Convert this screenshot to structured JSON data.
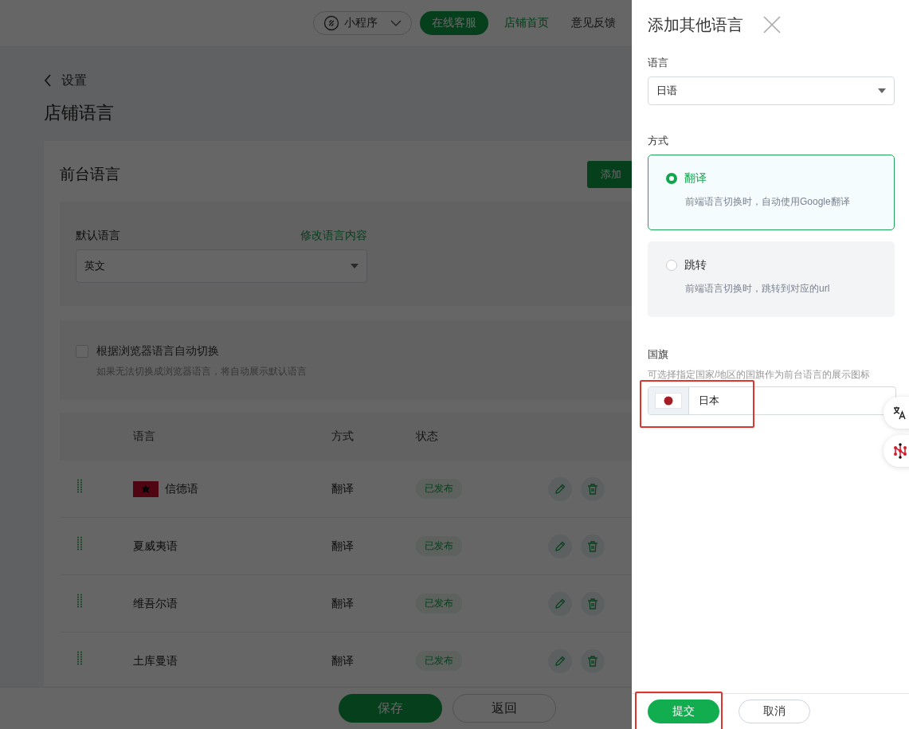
{
  "topbar": {
    "mini_program": "小程序",
    "service_button": "在线客服",
    "shop_home": "店铺首页",
    "feedback": "意见反馈"
  },
  "breadcrumb": {
    "back": "设置"
  },
  "page_title": "店铺语言",
  "card": {
    "title": "前台语言",
    "add_button": "添加"
  },
  "default_language": {
    "label": "默认语言",
    "edit_link": "修改语言内容",
    "value": "英文"
  },
  "auto_switch": {
    "label": "根据浏览器语言自动切换",
    "hint": "如果无法切换成浏览器语言，将自动展示默认语言",
    "checked": false
  },
  "table": {
    "columns": [
      "语言",
      "方式",
      "状态"
    ],
    "rows": [
      {
        "flag": true,
        "name": "信德语",
        "mode": "翻译",
        "status": "已发布"
      },
      {
        "flag": false,
        "name": "夏威夷语",
        "mode": "翻译",
        "status": "已发布"
      },
      {
        "flag": false,
        "name": "维吾尔语",
        "mode": "翻译",
        "status": "已发布"
      },
      {
        "flag": false,
        "name": "土库曼语",
        "mode": "翻译",
        "status": "已发布"
      }
    ]
  },
  "footer": {
    "save": "保存",
    "back": "返回"
  },
  "drawer": {
    "title": "添加其他语言",
    "language": {
      "label": "语言",
      "value": "日语"
    },
    "mode": {
      "label": "方式",
      "options": [
        {
          "label": "翻译",
          "description": "前端语言切换时，自动使用Google翻译",
          "selected": true
        },
        {
          "label": "跳转",
          "description": "前端语言切换时，跳转到对应的url",
          "selected": false
        }
      ]
    },
    "flag": {
      "label": "国旗",
      "hint": "可选择指定国家/地区的国旗作为前台语言的展示图标",
      "value": "日本",
      "highlighted": true
    },
    "buttons": {
      "submit": "提交",
      "cancel": "取消",
      "submit_highlighted": true
    }
  }
}
